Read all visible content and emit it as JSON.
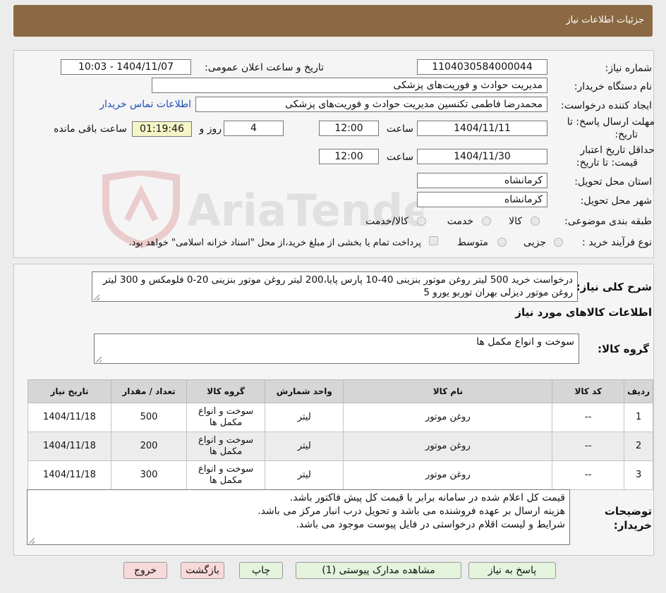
{
  "header": {
    "title": "جزئیات اطلاعات نیاز"
  },
  "form": {
    "need_number_label": "شماره نیاز:",
    "need_number": "1104030584000044",
    "announce_label": "تاریخ و ساعت اعلان عمومی:",
    "announce_value": "1404/11/07 - 10:03",
    "buyer_org_label": "نام دستگاه خریدار:",
    "buyer_org": "مدیریت حوادث و فوریت‌های پزشکی",
    "requester_label": "ایجاد کننده درخواست:",
    "requester": "محمدرضا فاطمی تکنسین مدیریت حوادث و فوریت‌های پزشکی",
    "contact_link": "اطلاعات تماس خریدار",
    "deadline_label_1": "مهلت ارسال پاسخ: تا",
    "deadline_label_2": "تاریخ:",
    "deadline_date": "1404/11/11",
    "time_label": "ساعت",
    "deadline_time": "12:00",
    "days_value": "4",
    "days_label": "روز و",
    "remaining_time": "01:19:46",
    "remaining_label": "ساعت باقی مانده",
    "validity_label_1": "حداقل تاریخ اعتبار",
    "validity_label_2": "قیمت: تا تاریخ:",
    "validity_date": "1404/11/30",
    "validity_time": "12:00",
    "province_label": "استان محل تحویل:",
    "province": "کرمانشاه",
    "city_label": "شهر محل تحویل:",
    "city": "کرمانشاه",
    "category_label": "طبقه بندی موضوعی:",
    "category_options": [
      "کالا",
      "خدمت",
      "کالا/خدمت"
    ],
    "process_label": "نوع فرآیند خرید :",
    "process_options": [
      "جزیی",
      "متوسط"
    ],
    "payment_note": "پرداخت تمام یا بخشی از مبلغ خرید،از محل \"اسناد خزانه اسلامی\" خواهد بود."
  },
  "summary": {
    "label": "شرح کلی نیاز:",
    "text": "درخواست خرید 500 لیتر روغن موتور بنزینی 40-10 پارس پایا،200 لیتر روغن موتور بنزینی 20-0 فلومکس و 300 لیتر روغن موتور دیزلی بهران توربو یورو 5",
    "goods_info_title": "اطلاعات کالاهای مورد نیاز",
    "goods_group_label": "گروه کالا:",
    "goods_group": "سوخت و انواع مکمل ها"
  },
  "table": {
    "headers": [
      "ردیف",
      "کد کالا",
      "نام کالا",
      "واحد شمارش",
      "گروه کالا",
      "تعداد / مقدار",
      "تاریخ نیاز"
    ],
    "rows": [
      [
        "1",
        "--",
        "روغن موتور",
        "لیتر",
        "سوخت و انواع مکمل ها",
        "500",
        "1404/11/18"
      ],
      [
        "2",
        "--",
        "روغن موتور",
        "لیتر",
        "سوخت و انواع مکمل ها",
        "200",
        "1404/11/18"
      ],
      [
        "3",
        "--",
        "روغن موتور",
        "لیتر",
        "سوخت و انواع مکمل ها",
        "300",
        "1404/11/18"
      ]
    ]
  },
  "buyer_notes": {
    "label_1": "توضیحات",
    "label_2": "خریدار:",
    "lines": [
      "قیمت کل اعلام شده در سامانه برابر با قیمت کل پیش فاکتور باشد.",
      "هزینه ارسال بر عهده فروشنده می باشد و تحویل درب انبار مرکز می باشد.",
      "شرایط و لیست اقلام درخواستی در فایل پیوست موجود می باشد."
    ]
  },
  "buttons": {
    "reply": "پاسخ به نیاز",
    "attachments": "مشاهده مدارک پیوستی (1)",
    "print": "چاپ",
    "back": "بازگشت",
    "exit": "خروج"
  },
  "watermark": {
    "text": "AriaTender.neT"
  },
  "colors": {
    "header": "#8b6a43",
    "button_green": "#e3f3dc",
    "button_red": "#f8d9d9",
    "link": "#1a4fb4"
  }
}
